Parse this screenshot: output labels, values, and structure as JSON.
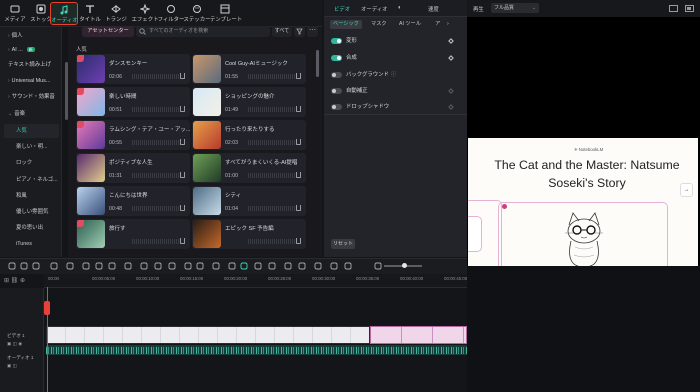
{
  "top_tabs": [
    {
      "label": "メディア",
      "icon": "media-icon"
    },
    {
      "label": "ストック",
      "icon": "stock-icon"
    },
    {
      "label": "オーディオ",
      "icon": "music-note-icon"
    },
    {
      "label": "タイトル",
      "icon": "title-t-icon"
    },
    {
      "label": "トランジ",
      "icon": "transition-icon"
    },
    {
      "label": "エフェクト",
      "icon": "effect-icon"
    },
    {
      "label": "フィルター",
      "icon": "filter-icon"
    },
    {
      "label": "ステッカー",
      "icon": "sticker-icon"
    },
    {
      "label": "テンプレート",
      "icon": "template-icon"
    }
  ],
  "sidebar": {
    "items": [
      {
        "label": "個人",
        "type": "section"
      },
      {
        "label": "AI ...",
        "badge": "新",
        "type": "section"
      },
      {
        "label": "テキスト読み上げ",
        "type": "section"
      },
      {
        "label": "Universal Mus...",
        "type": "section"
      },
      {
        "label": "サウンド・効果音",
        "type": "section"
      },
      {
        "label": "音楽",
        "type": "section"
      },
      {
        "label": "人気",
        "type": "sub",
        "active": true
      },
      {
        "label": "楽しい・明...",
        "type": "sub"
      },
      {
        "label": "ロック",
        "type": "sub"
      },
      {
        "label": "ピアノ・ネルゴ...",
        "type": "sub",
        "dot": true
      },
      {
        "label": "和風",
        "type": "sub"
      },
      {
        "label": "優しい雰囲気",
        "type": "sub"
      },
      {
        "label": "夏の思い出",
        "type": "sub"
      },
      {
        "label": "iTunes",
        "type": "sub"
      }
    ]
  },
  "library": {
    "asset_center": "アセットセンター",
    "search_placeholder": "すべてのオーディオを検索",
    "filter_all": "すべて",
    "section_title": "人気",
    "tracks": [
      {
        "title": "ダンスモンキー",
        "duration": "02:06",
        "fav": true
      },
      {
        "title": "Cool Guy-AIミュージック",
        "duration": "01:55"
      },
      {
        "title": "楽しい時間",
        "duration": "00:51",
        "fav": true
      },
      {
        "title": "ショッピングの魅介",
        "duration": "01:49"
      },
      {
        "title": "ラムシング・テア・ユー・アッ...",
        "duration": "00:55",
        "fav": true
      },
      {
        "title": "行ったり来たりする",
        "duration": "02:03"
      },
      {
        "title": "ポジティブな人生",
        "duration": "01:31"
      },
      {
        "title": "すべてがうまくいくる-AI提唱",
        "duration": "01:00"
      },
      {
        "title": "こんにちは世界",
        "duration": "00:48"
      },
      {
        "title": "シティ",
        "duration": "01:04"
      },
      {
        "title": "旅行す",
        "duration": "",
        "fav": true
      },
      {
        "title": "エピック SF 予告編",
        "duration": ""
      }
    ]
  },
  "props": {
    "tabs": [
      "ビデオ",
      "オーディオ",
      "カラー",
      "速度"
    ],
    "subtabs": [
      "ベーシック",
      "マスク",
      "AI ツール",
      "ア"
    ],
    "rows": [
      {
        "label": "変形",
        "on": true
      },
      {
        "label": "合成",
        "on": true
      },
      {
        "label": "バックグラウンド",
        "on": false
      },
      {
        "label": "自動補正",
        "on": false
      },
      {
        "label": "ドロップシャドウ",
        "on": false
      }
    ],
    "reset": "リセット"
  },
  "preview": {
    "play_label": "再生",
    "quality": "フル品質",
    "brand": "NotebookLM",
    "slide_title": "The Cat and the Master: Natsume Soseki's Story",
    "next": "→"
  },
  "timeline": {
    "ruler": [
      "00:00",
      "00:00:05:00",
      "00:00:10:00",
      "00:00:15:00",
      "00:00:20:00",
      "00:00:25:00",
      "00:00:30:00",
      "00:00:35:00",
      "00:00:40:00",
      "00:00:45:00"
    ],
    "video_track": "ビデオ 1",
    "audio_track": "オーディオ 1"
  },
  "colors": {
    "accent": "#3fd5b7",
    "highlight_border": "#e8412e",
    "playhead": "#e8413c"
  }
}
